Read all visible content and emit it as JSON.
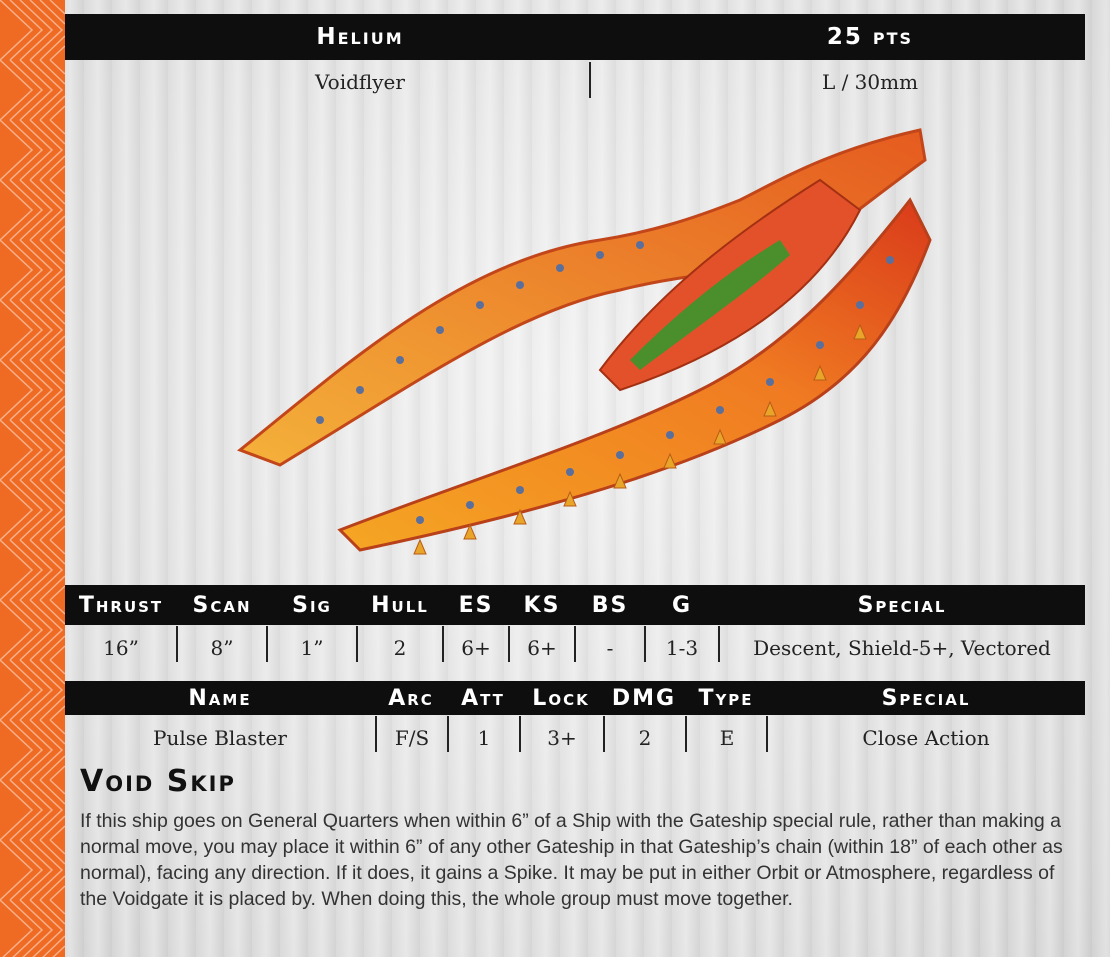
{
  "header": {
    "name": "Helium",
    "points": "25 pts"
  },
  "subheader": {
    "class": "Voidflyer",
    "size": "L / 30mm"
  },
  "ship_image": {
    "description_icon": "ship-model-icon"
  },
  "stats": {
    "headers": [
      "Thrust",
      "Scan",
      "Sig",
      "Hull",
      "ES",
      "KS",
      "BS",
      "G",
      "Special"
    ],
    "values": [
      "16”",
      "8”",
      "1”",
      "2",
      "6+",
      "6+",
      "-",
      "1-3",
      "Descent, Shield-5+, Vectored"
    ]
  },
  "weapons": {
    "headers": [
      "Name",
      "Arc",
      "Att",
      "Lock",
      "DMG",
      "Type",
      "Special"
    ],
    "rows": [
      [
        "Pulse Blaster",
        "F/S",
        "1",
        "3+",
        "2",
        "E",
        "Close Action"
      ]
    ]
  },
  "rule": {
    "title": "Void Skip",
    "text": "If this ship goes on General Quarters when within 6” of a Ship with the Gateship special rule, rather than making a normal move, you may place it within 6” of any other Gateship in that Gateship’s chain (within 18” of each other as normal), facing any direction. If it does, it gains a Spike. It may be put in either Orbit or Atmosphere, regardless of the Voidgate it is placed by. When doing this, the whole group must move together."
  },
  "colors": {
    "accent": "#ef6a23",
    "bar": "#0e0e0e"
  }
}
